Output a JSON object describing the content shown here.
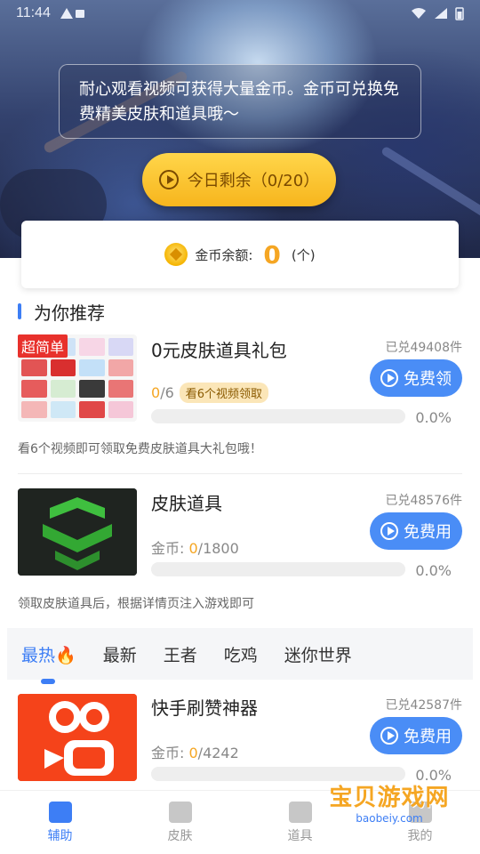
{
  "status_bar": {
    "time": "11:44"
  },
  "hero": {
    "tip": "耐心观看视频可获得大量金币。金币可兑换免费精美皮肤和道具哦～",
    "today_button": "今日剩余（0/20）"
  },
  "coin": {
    "label": "金币余额:",
    "value": "0",
    "unit": "(个)"
  },
  "section": {
    "title": "为你推荐"
  },
  "items": [
    {
      "badge": "超简单",
      "title": "0元皮肤道具礼包",
      "count": "已兑49408件",
      "button": "免费领",
      "progress_done": "0",
      "progress_total": "/6",
      "tag": "看6个视频领取",
      "percent": "0.0%",
      "desc": "看6个视频即可领取免费皮肤道具大礼包哦！"
    },
    {
      "title": "皮肤道具",
      "count": "已兑48576件",
      "button": "免费用",
      "progress_label": "金币: ",
      "progress_done": "0",
      "progress_total": "/1800",
      "percent": "0.0%",
      "desc": "领取皮肤道具后，根据详情页注入游戏即可"
    },
    {
      "title": "快手刷赞神器",
      "count": "已兑42587件",
      "button": "免费用",
      "progress_label": "金币: ",
      "progress_done": "0",
      "progress_total": "/4242",
      "percent": "0.0%"
    }
  ],
  "tabs": [
    "最热",
    "最新",
    "王者",
    "吃鸡",
    "迷你世界"
  ],
  "bottom_nav": [
    {
      "label": "辅助",
      "icon": "auxiliary-icon"
    },
    {
      "label": "皮肤",
      "icon": "shirt-icon"
    },
    {
      "label": "道具",
      "icon": "box-icon"
    },
    {
      "label": "我的",
      "icon": "profile-icon"
    }
  ],
  "watermark": {
    "main": "宝贝游戏网",
    "sub": "baobeiy.com"
  },
  "colors": {
    "accent": "#3d7ef5",
    "gold": "#f5a623",
    "badge_red": "#e8312c"
  }
}
